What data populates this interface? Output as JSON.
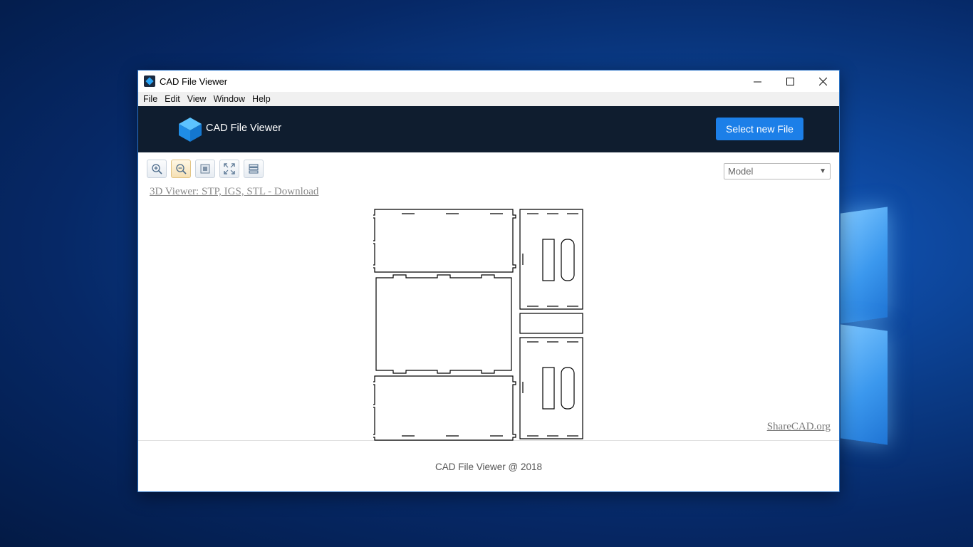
{
  "window": {
    "title": "CAD File Viewer"
  },
  "menu": [
    "File",
    "Edit",
    "View",
    "Window",
    "Help"
  ],
  "header": {
    "brand": "CAD File Viewer",
    "select_button": "Select new File",
    "accent": "#1c7fe8",
    "background": "#0f1d2f"
  },
  "toolbar": {
    "tools": [
      {
        "icon": "zoom-in-icon",
        "active": false
      },
      {
        "icon": "zoom-out-icon",
        "active": true
      },
      {
        "icon": "fit-icon",
        "active": false
      },
      {
        "icon": "fullscreen-icon",
        "active": false
      },
      {
        "icon": "layers-icon",
        "active": false
      }
    ]
  },
  "viewer": {
    "layout_value": "Model",
    "link_3d": "3D Viewer: STP, IGS, STL - Download",
    "sharecad": "ShareCAD.org"
  },
  "footer": {
    "text": "CAD File Viewer @ 2018"
  }
}
